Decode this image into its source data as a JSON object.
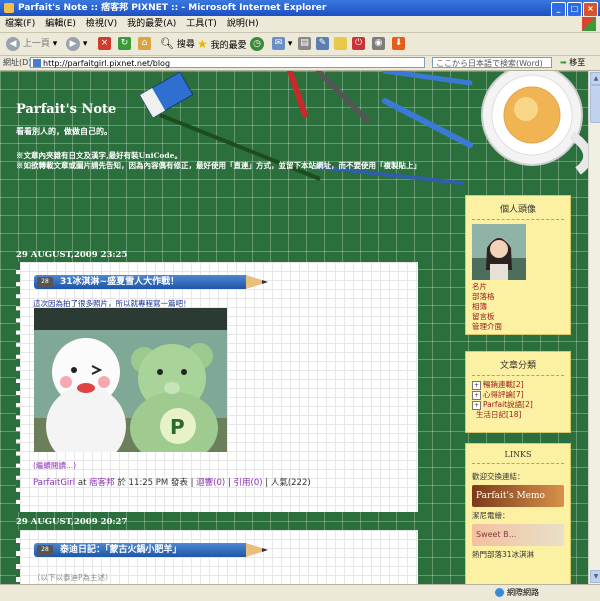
{
  "window": {
    "title": "Parfait's Note :: 痞客邦 PIXNET :: - Microsoft Internet Explorer"
  },
  "menu": {
    "items": [
      "檔案(F)",
      "編輯(E)",
      "檢視(V)",
      "我的最愛(A)",
      "工具(T)",
      "說明(H)"
    ]
  },
  "toolbar": {
    "back": "上一頁",
    "search": "搜尋",
    "favorites": "我的最愛"
  },
  "address": {
    "label": "網址(D)",
    "url": "http://parfaitgirl.pixnet.net/blog",
    "search_placeholder": "ここから日本語で検索(Word)",
    "go": "移至"
  },
  "blog": {
    "title": "Parfait's Note",
    "subtitle": "看看別人的，做做自己的。",
    "notice_lines": [
      "※文章內夾雜有日文及漢字,最好有裝UniCode。",
      "※如欲轉載文章或圖片請先告知，因為內容偶有修正，最好使用「直連」方式，並留下本站網址，而不要使用「複製貼上」"
    ]
  },
  "posts": [
    {
      "date": "29 AUGUST,2009 23:25",
      "day": "28",
      "title": "31冰淇淋~盛夏雪人大作戰！",
      "intro": "這次因為拍了很多照片，所以就專程寫一篇吧！",
      "readmore": "(繼續閱讀...)",
      "author": "ParfaitGirl",
      "at": "at",
      "site": "痞客邦",
      "time": "於 11:25 PM 發表",
      "comments": "迴響(0)",
      "trackback": "引用(0)",
      "views": "人氣(222)"
    },
    {
      "date": "29 AUGUST,2009 20:27",
      "day": "28",
      "title": "泰迪日記：「蒙古火鍋小肥羊」",
      "intro": "（以下以泰迪P為主述）"
    }
  ],
  "sidebar": {
    "profile": {
      "heading": "個人頭像",
      "links": [
        "名片",
        "部落格",
        "相簿",
        "留言板",
        "管理介面"
      ]
    },
    "categories": {
      "heading": "文章分類",
      "items": [
        {
          "label": "暢銷連載",
          "count": "[2]",
          "expand": "+"
        },
        {
          "label": "心得評論",
          "count": "[7]",
          "expand": "+"
        },
        {
          "label": "Parfait說語",
          "count": "[2]",
          "expand": "+"
        },
        {
          "label": "生活日記",
          "count": "[18]",
          "expand": ""
        }
      ]
    },
    "links": {
      "heading": "LINKS",
      "items": [
        {
          "label": "歡迎交換連結：",
          "banner": "Parfait's Memo"
        },
        {
          "label": "潔尼電繪：",
          "banner": "Sweet B..."
        },
        {
          "label": "熱門部落31冰淇淋"
        }
      ]
    }
  },
  "status": {
    "zone": "網際網路"
  },
  "colors": {
    "board": "#2a6f3c",
    "pencil": "#1e56a8",
    "sidebox": "#fcf0a2",
    "link": "#8b2fb5"
  }
}
